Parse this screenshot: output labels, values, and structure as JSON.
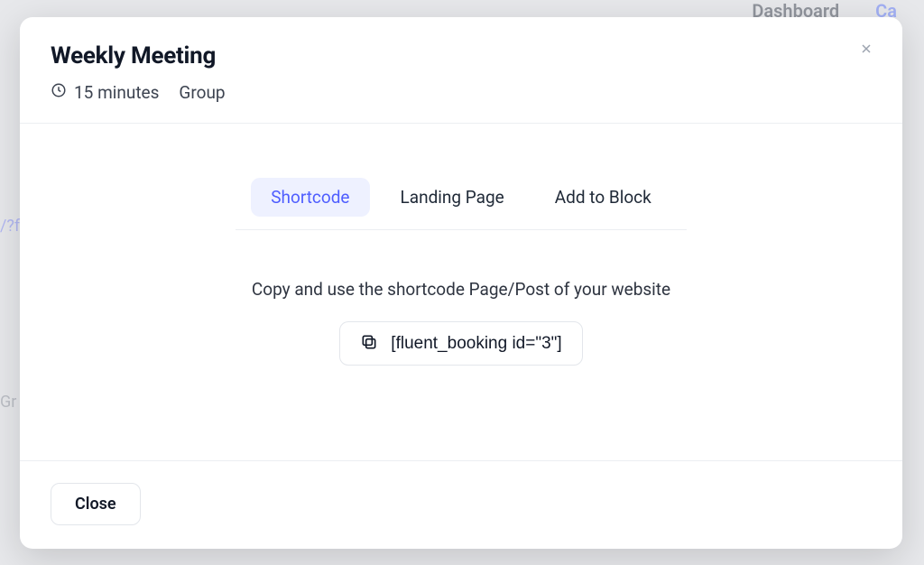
{
  "backdrop": {
    "nav_dashboard": "Dashboard",
    "nav_cal_fragment": "Ca",
    "left_fragment_1": "/?fl",
    "left_fragment_2": "Gr"
  },
  "modal": {
    "title": "Weekly Meeting",
    "duration": "15 minutes",
    "type": "Group",
    "tabs": {
      "shortcode": "Shortcode",
      "landing": "Landing Page",
      "block": "Add to Block"
    },
    "instruction": "Copy and use the shortcode Page/Post of your website",
    "shortcode_value": "[fluent_booking id=\"3\"]",
    "close_label": "Close"
  }
}
